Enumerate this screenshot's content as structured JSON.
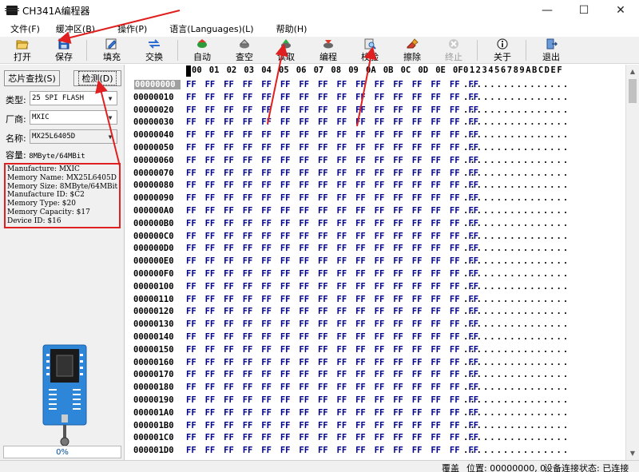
{
  "window": {
    "title": "CH341A编程器",
    "minimize": "—",
    "maximize": "☐",
    "close": "✕"
  },
  "menu": [
    {
      "label": "文件(F)"
    },
    {
      "label": "缓冲区(B)"
    },
    {
      "label": "操作(P)"
    },
    {
      "label": "语言(Languages)(L)"
    },
    {
      "label": "帮助(H)"
    }
  ],
  "toolbar": {
    "open": "打开",
    "save": "保存",
    "fill": "填充",
    "swap": "交换",
    "auto": "自动",
    "blank_check": "查空",
    "read": "读取",
    "program": "编程",
    "verify": "校验",
    "erase": "擦除",
    "stop": "终止",
    "about": "关于",
    "exit": "退出"
  },
  "left": {
    "chip_search": "芯片查找(S)",
    "detect": "检测(D)",
    "type_label": "类型:",
    "type_value": "25 SPI FLASH",
    "vendor_label": "厂商:",
    "vendor_value": "MXIC",
    "name_label": "名称:",
    "name_value": "MX25L6405D",
    "capacity_label": "容量:",
    "capacity_value": "8MByte/64MBit",
    "info": [
      "Manufacture: MXIC",
      "Memory Name: MX25L6405D",
      "Memory Size: 8MByte/64MBit",
      "Manufacture ID: $C2",
      "Memory Type: $20",
      "Memory Capacity: $17",
      "Device ID: $16"
    ],
    "progress": "0%"
  },
  "hex": {
    "columns": [
      "00",
      "01",
      "02",
      "03",
      "04",
      "05",
      "06",
      "07",
      "08",
      "09",
      "0A",
      "0B",
      "0C",
      "0D",
      "0E",
      "0F"
    ],
    "ascii_header": "0123456789ABCDEF",
    "rows": [
      {
        "addr": "00000000",
        "bytes": "FF FF FF FF FF FF FF FF FF FF FF FF FF FF FF FF",
        "ascii": "................"
      },
      {
        "addr": "00000010",
        "bytes": "FF FF FF FF FF FF FF FF FF FF FF FF FF FF FF FF",
        "ascii": "................"
      },
      {
        "addr": "00000020",
        "bytes": "FF FF FF FF FF FF FF FF FF FF FF FF FF FF FF FF",
        "ascii": "................"
      },
      {
        "addr": "00000030",
        "bytes": "FF FF FF FF FF FF FF FF FF FF FF FF FF FF FF FF",
        "ascii": "................"
      },
      {
        "addr": "00000040",
        "bytes": "FF FF FF FF FF FF FF FF FF FF FF FF FF FF FF FF",
        "ascii": "................"
      },
      {
        "addr": "00000050",
        "bytes": "FF FF FF FF FF FF FF FF FF FF FF FF FF FF FF FF",
        "ascii": "................"
      },
      {
        "addr": "00000060",
        "bytes": "FF FF FF FF FF FF FF FF FF FF FF FF FF FF FF FF",
        "ascii": "................"
      },
      {
        "addr": "00000070",
        "bytes": "FF FF FF FF FF FF FF FF FF FF FF FF FF FF FF FF",
        "ascii": "................"
      },
      {
        "addr": "00000080",
        "bytes": "FF FF FF FF FF FF FF FF FF FF FF FF FF FF FF FF",
        "ascii": "................"
      },
      {
        "addr": "00000090",
        "bytes": "FF FF FF FF FF FF FF FF FF FF FF FF FF FF FF FF",
        "ascii": "................"
      },
      {
        "addr": "000000A0",
        "bytes": "FF FF FF FF FF FF FF FF FF FF FF FF FF FF FF FF",
        "ascii": "................"
      },
      {
        "addr": "000000B0",
        "bytes": "FF FF FF FF FF FF FF FF FF FF FF FF FF FF FF FF",
        "ascii": "................"
      },
      {
        "addr": "000000C0",
        "bytes": "FF FF FF FF FF FF FF FF FF FF FF FF FF FF FF FF",
        "ascii": "................"
      },
      {
        "addr": "000000D0",
        "bytes": "FF FF FF FF FF FF FF FF FF FF FF FF FF FF FF FF",
        "ascii": "................"
      },
      {
        "addr": "000000E0",
        "bytes": "FF FF FF FF FF FF FF FF FF FF FF FF FF FF FF FF",
        "ascii": "................"
      },
      {
        "addr": "000000F0",
        "bytes": "FF FF FF FF FF FF FF FF FF FF FF FF FF FF FF FF",
        "ascii": "................"
      },
      {
        "addr": "00000100",
        "bytes": "FF FF FF FF FF FF FF FF FF FF FF FF FF FF FF FF",
        "ascii": "................"
      },
      {
        "addr": "00000110",
        "bytes": "FF FF FF FF FF FF FF FF FF FF FF FF FF FF FF FF",
        "ascii": "................"
      },
      {
        "addr": "00000120",
        "bytes": "FF FF FF FF FF FF FF FF FF FF FF FF FF FF FF FF",
        "ascii": "................"
      },
      {
        "addr": "00000130",
        "bytes": "FF FF FF FF FF FF FF FF FF FF FF FF FF FF FF FF",
        "ascii": "................"
      },
      {
        "addr": "00000140",
        "bytes": "FF FF FF FF FF FF FF FF FF FF FF FF FF FF FF FF",
        "ascii": "................"
      },
      {
        "addr": "00000150",
        "bytes": "FF FF FF FF FF FF FF FF FF FF FF FF FF FF FF FF",
        "ascii": "................"
      },
      {
        "addr": "00000160",
        "bytes": "FF FF FF FF FF FF FF FF FF FF FF FF FF FF FF FF",
        "ascii": "................"
      },
      {
        "addr": "00000170",
        "bytes": "FF FF FF FF FF FF FF FF FF FF FF FF FF FF FF FF",
        "ascii": "................"
      },
      {
        "addr": "00000180",
        "bytes": "FF FF FF FF FF FF FF FF FF FF FF FF FF FF FF FF",
        "ascii": "................"
      },
      {
        "addr": "00000190",
        "bytes": "FF FF FF FF FF FF FF FF FF FF FF FF FF FF FF FF",
        "ascii": "................"
      },
      {
        "addr": "000001A0",
        "bytes": "FF FF FF FF FF FF FF FF FF FF FF FF FF FF FF FF",
        "ascii": "................"
      },
      {
        "addr": "000001B0",
        "bytes": "FF FF FF FF FF FF FF FF FF FF FF FF FF FF FF FF",
        "ascii": "................"
      },
      {
        "addr": "000001C0",
        "bytes": "FF FF FF FF FF FF FF FF FF FF FF FF FF FF FF FF",
        "ascii": "................"
      },
      {
        "addr": "000001D0",
        "bytes": "FF FF FF FF FF FF FF FF FF FF FF FF FF FF FF FF",
        "ascii": "................"
      }
    ]
  },
  "status": {
    "mode": "覆盖",
    "position": "位置: 00000000, 0",
    "device_status": "设备连接状态: 已连接"
  }
}
